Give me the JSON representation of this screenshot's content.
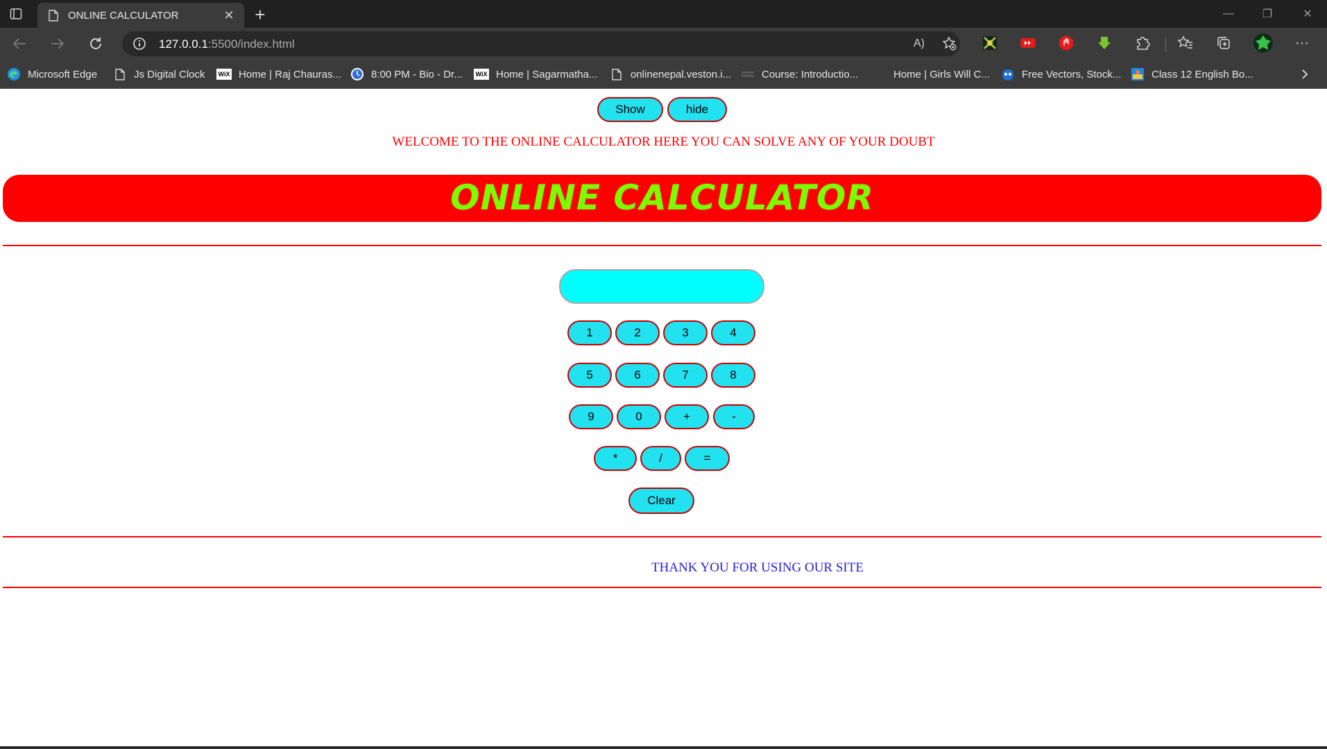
{
  "browser": {
    "tab": {
      "title": "ONLINE CALCULATOR",
      "close_glyph": "✕"
    },
    "new_tab_glyph": "+",
    "window": {
      "minimize": "—",
      "restore": "❐",
      "close": "✕"
    },
    "address": {
      "host": "127.0.0.1",
      "rest": ":5500/index.html"
    },
    "read_aloud_label": "A)",
    "more_glyph": "···",
    "bookmarks": [
      {
        "label": "Microsoft Edge",
        "icon": "edge-icon"
      },
      {
        "label": "Js Digital Clock",
        "icon": "page-icon"
      },
      {
        "label": "Home | Raj Chauras...",
        "icon": "wix-icon"
      },
      {
        "label": "8:00 PM - Bio - Dr...",
        "icon": "clock-icon"
      },
      {
        "label": "Home | Sagarmatha...",
        "icon": "wix-icon"
      },
      {
        "label": "onlinenepal.veston.i...",
        "icon": "page-icon"
      },
      {
        "label": "Course: Introductio...",
        "icon": "course-icon"
      },
      {
        "label": "Home | Girls Will C...",
        "icon": "blank-icon"
      },
      {
        "label": "Free Vectors, Stock...",
        "icon": "freepik-icon"
      },
      {
        "label": "Class 12 English Bo...",
        "icon": "book-icon"
      }
    ],
    "wix_text": "WiX"
  },
  "page": {
    "show_label": "Show",
    "hide_label": "hide",
    "welcome_text": "WELCOME TO THE ONLINE CALCULATOR HERE YOU CAN SOLVE ANY OF YOUR DOUBT",
    "banner_title": "ONLINE CALCULATOR",
    "display_value": "",
    "keys": {
      "row1": [
        "1",
        "2",
        "3",
        "4"
      ],
      "row2": [
        "5",
        "6",
        "7",
        "8"
      ],
      "row3": [
        "9",
        "0",
        "+",
        "-"
      ],
      "row4": [
        "*",
        "/",
        "="
      ]
    },
    "clear_label": "Clear",
    "thanks_text": "THANK YOU FOR USING OUR SITE"
  },
  "colors": {
    "accent_red": "#ff0000",
    "button_fill": "#22e2f0",
    "display_fill": "#00ffff",
    "banner_text": "#7cfc00",
    "thanks_text": "#2a1bd6"
  }
}
